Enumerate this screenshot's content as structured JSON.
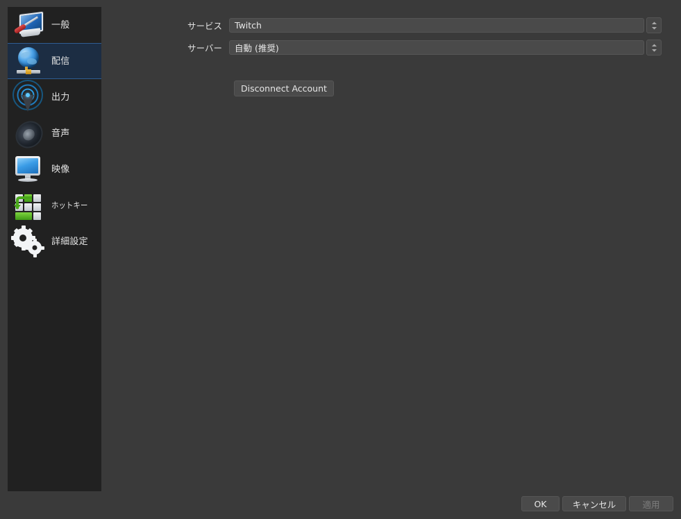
{
  "sidebar": {
    "items": [
      {
        "label": "一般",
        "icon": "monitor-screwdriver-icon",
        "name": "general",
        "selected": false
      },
      {
        "label": "配信",
        "icon": "globe-icon",
        "name": "stream",
        "selected": true
      },
      {
        "label": "出力",
        "icon": "broadcast-tower-icon",
        "name": "output",
        "selected": false
      },
      {
        "label": "音声",
        "icon": "speaker-icon",
        "name": "audio",
        "selected": false
      },
      {
        "label": "映像",
        "icon": "monitor-icon",
        "name": "video",
        "selected": false
      },
      {
        "label": "ホットキー",
        "icon": "keyboard-keys-icon",
        "name": "hotkeys",
        "selected": false
      },
      {
        "label": "詳細設定",
        "icon": "gears-icon",
        "name": "advanced",
        "selected": false
      }
    ]
  },
  "main": {
    "service": {
      "label": "サービス",
      "value": "Twitch"
    },
    "server": {
      "label": "サーバー",
      "value": "自動 (推奨)"
    },
    "disconnect_button": "Disconnect Account"
  },
  "footer": {
    "ok": "OK",
    "cancel": "キャンセル",
    "apply": "適用",
    "apply_disabled": true
  },
  "colors": {
    "window_bg": "#3a3a3a",
    "sidebar_bg": "#212121",
    "selection_bg": "#1c2d43",
    "selection_border": "#2f5d92",
    "field_bg": "#4a4a4a",
    "text": "#e4e4e4",
    "text_disabled": "#7d7d7d"
  }
}
